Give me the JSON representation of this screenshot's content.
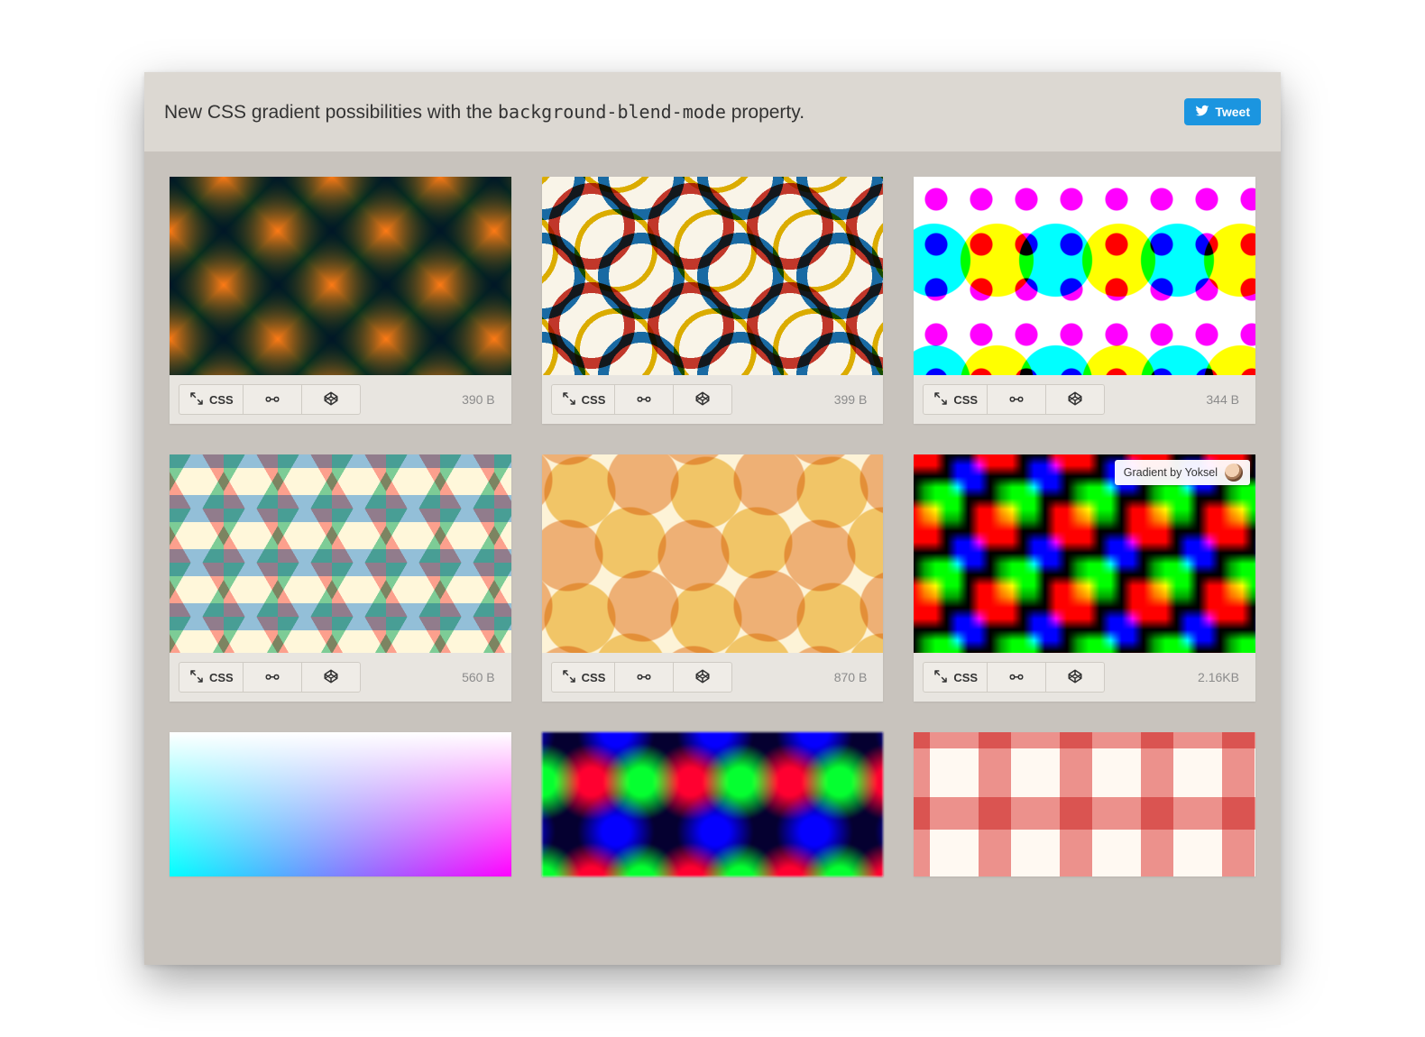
{
  "header": {
    "title_prefix": "New CSS gradient possibilities with the ",
    "title_code": "background-blend-mode",
    "title_suffix": " property.",
    "tweet_label": "Tweet"
  },
  "toolbar": {
    "css_label": "CSS"
  },
  "credit": {
    "label": "Gradient by Yoksel"
  },
  "cards": [
    {
      "size": "390 B",
      "pattern": "p1"
    },
    {
      "size": "399 B",
      "pattern": "p2"
    },
    {
      "size": "344 B",
      "pattern": "p3"
    },
    {
      "size": "560 B",
      "pattern": "p4"
    },
    {
      "size": "870 B",
      "pattern": "p5"
    },
    {
      "size": "2.16KB",
      "pattern": "p6",
      "credit": true
    },
    {
      "size": "",
      "pattern": "p7",
      "partial": true
    },
    {
      "size": "",
      "pattern": "p8",
      "partial": true
    },
    {
      "size": "",
      "pattern": "p9",
      "partial": true
    }
  ]
}
